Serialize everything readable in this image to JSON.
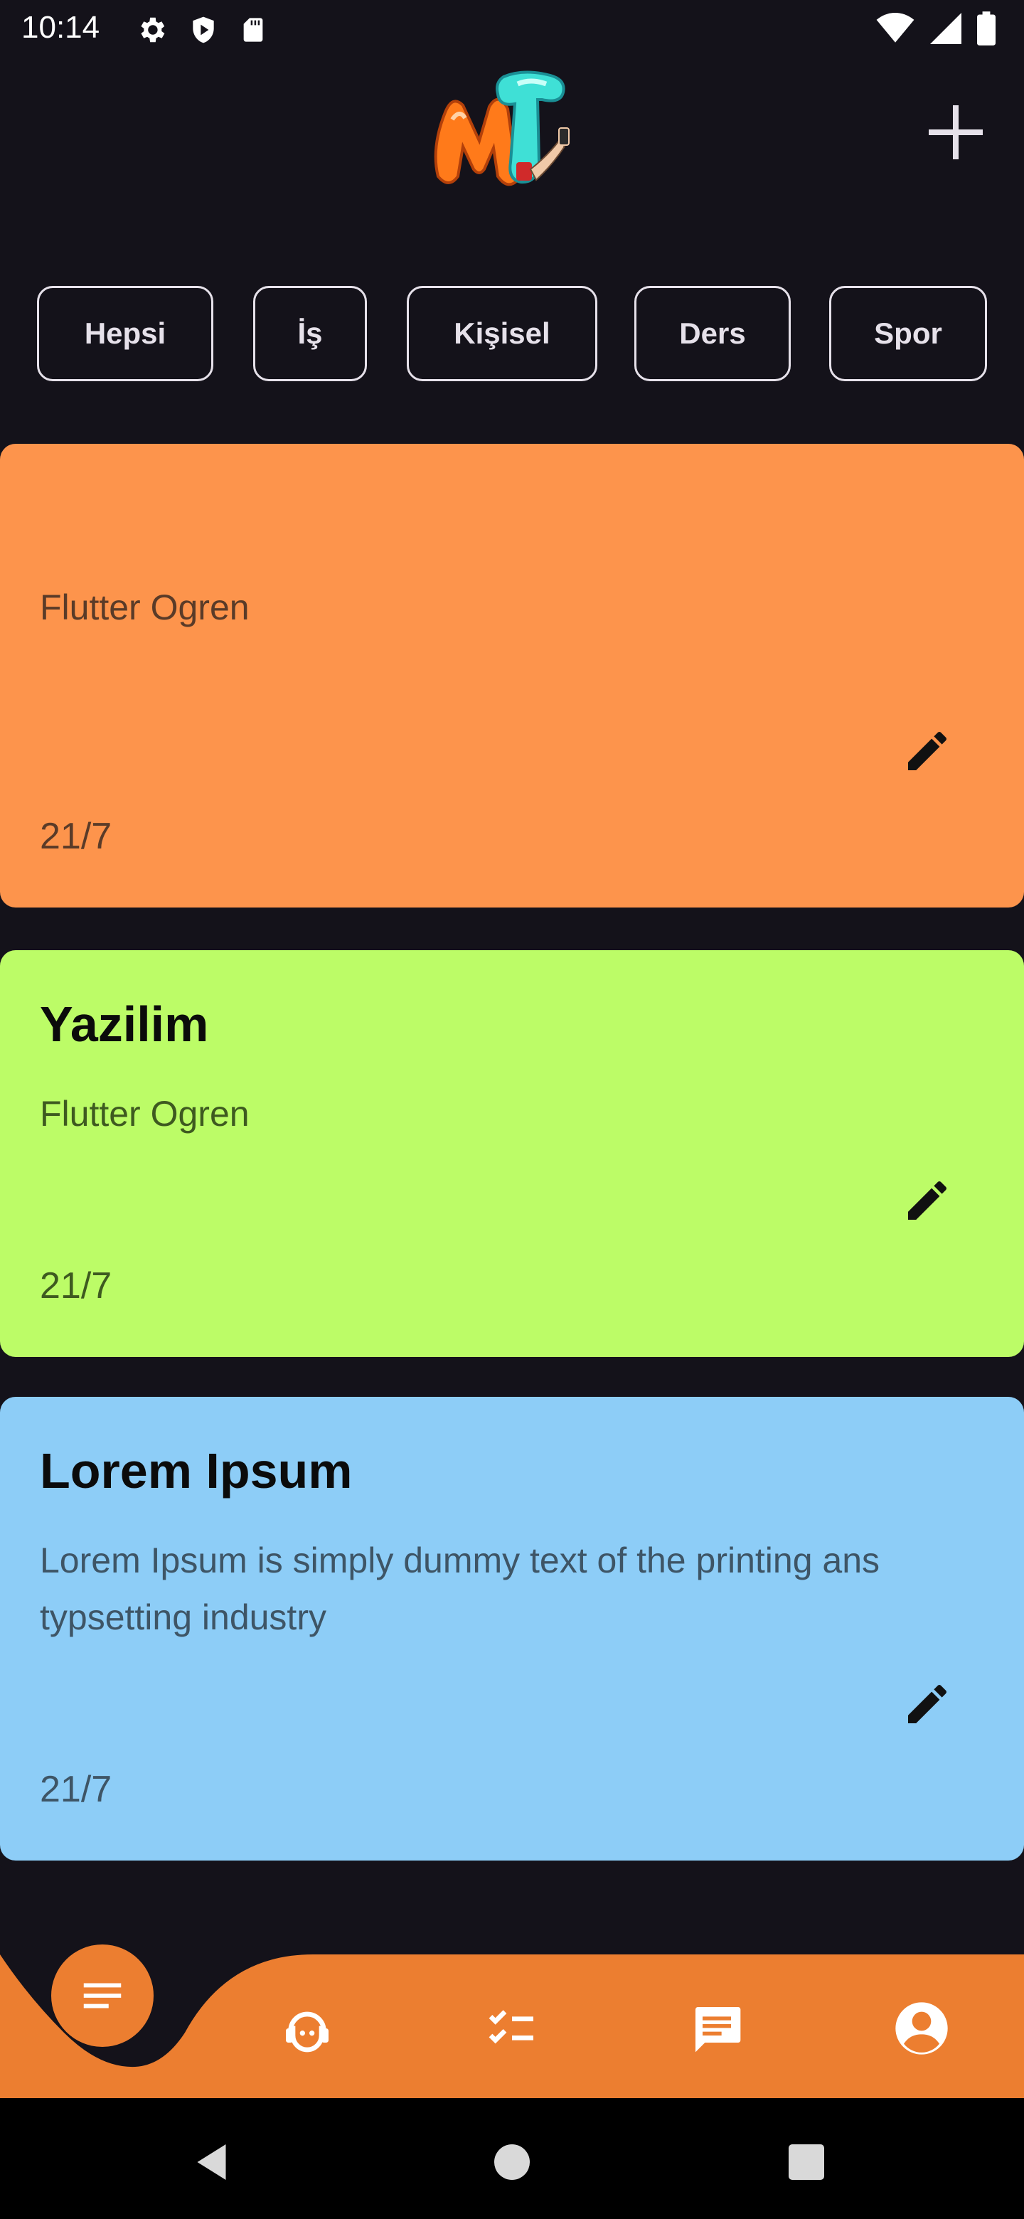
{
  "status_bar": {
    "time": "10:14",
    "left_icons": [
      "gear-icon",
      "shield-icon",
      "sd-card-icon"
    ],
    "right_icons": [
      "wifi-icon",
      "signal-icon",
      "battery-icon"
    ]
  },
  "header": {
    "logo_icon": "mt-logo",
    "add_icon": "plus-icon"
  },
  "filters": [
    {
      "label": "Hepsi"
    },
    {
      "label": "İş"
    },
    {
      "label": "Kişisel"
    },
    {
      "label": "Ders"
    },
    {
      "label": "Spor"
    }
  ],
  "notes": [
    {
      "title": "",
      "body": "Flutter Ogren",
      "date": "21/7",
      "color": "#fd944c"
    },
    {
      "title": "Yazilim",
      "body": "Flutter Ogren",
      "date": "21/7",
      "color": "#bcfc67"
    },
    {
      "title": "Lorem Ipsum",
      "body": "Lorem Ipsum is simply dummy text of the printing ans typsetting industry",
      "date": "21/7",
      "color": "#8dcdf7"
    }
  ],
  "bottom_nav": {
    "background": "#ec7e30",
    "items": [
      "menu-icon",
      "support-agent-icon",
      "checklist-icon",
      "chat-icon",
      "account-icon"
    ]
  },
  "system_nav": [
    "back-icon",
    "home-icon",
    "recents-icon"
  ]
}
